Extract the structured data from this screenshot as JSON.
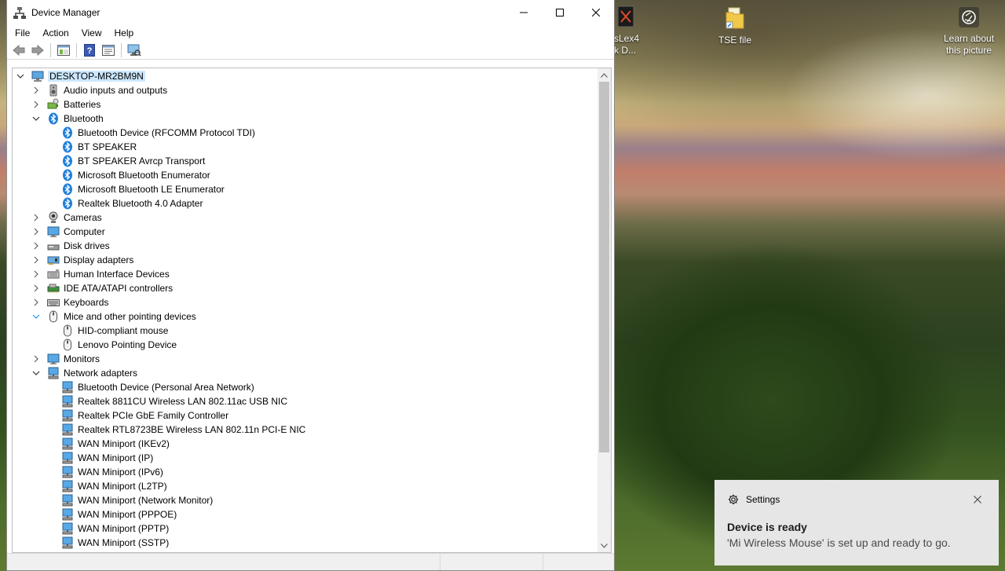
{
  "window": {
    "title": "Device Manager",
    "menu": [
      "File",
      "Action",
      "View",
      "Help"
    ]
  },
  "tree": [
    {
      "label": "DESKTOP-MR2BM9N",
      "level": 0,
      "toggle": "expanded",
      "icon": "computer-icon"
    },
    {
      "label": "Audio inputs and outputs",
      "level": 1,
      "toggle": "collapsed",
      "icon": "speaker-icon"
    },
    {
      "label": "Batteries",
      "level": 1,
      "toggle": "collapsed",
      "icon": "battery-icon"
    },
    {
      "label": "Bluetooth",
      "level": 1,
      "toggle": "expanded",
      "icon": "bluetooth-icon"
    },
    {
      "label": "Bluetooth Device (RFCOMM Protocol TDI)",
      "level": 2,
      "icon": "bluetooth-icon"
    },
    {
      "label": "BT SPEAKER",
      "level": 2,
      "icon": "bluetooth-icon"
    },
    {
      "label": "BT SPEAKER Avrcp Transport",
      "level": 2,
      "icon": "bluetooth-icon"
    },
    {
      "label": "Microsoft Bluetooth Enumerator",
      "level": 2,
      "icon": "bluetooth-icon"
    },
    {
      "label": "Microsoft Bluetooth LE Enumerator",
      "level": 2,
      "icon": "bluetooth-icon"
    },
    {
      "label": "Realtek Bluetooth 4.0 Adapter",
      "level": 2,
      "icon": "bluetooth-icon"
    },
    {
      "label": "Cameras",
      "level": 1,
      "toggle": "collapsed",
      "icon": "camera-icon"
    },
    {
      "label": "Computer",
      "level": 1,
      "toggle": "collapsed",
      "icon": "monitor-icon"
    },
    {
      "label": "Disk drives",
      "level": 1,
      "toggle": "collapsed",
      "icon": "disk-icon"
    },
    {
      "label": "Display adapters",
      "level": 1,
      "toggle": "collapsed",
      "icon": "display-adapter-icon"
    },
    {
      "label": "Human Interface Devices",
      "level": 1,
      "toggle": "collapsed",
      "icon": "hid-icon"
    },
    {
      "label": "IDE ATA/ATAPI controllers",
      "level": 1,
      "toggle": "collapsed",
      "icon": "ide-controller-icon"
    },
    {
      "label": "Keyboards",
      "level": 1,
      "toggle": "collapsed",
      "icon": "keyboard-icon"
    },
    {
      "label": "Mice and other pointing devices",
      "level": 1,
      "toggle": "expanded-hover",
      "icon": "mouse-icon"
    },
    {
      "label": "HID-compliant mouse",
      "level": 2,
      "icon": "mouse-icon"
    },
    {
      "label": "Lenovo Pointing Device",
      "level": 2,
      "icon": "mouse-icon"
    },
    {
      "label": "Monitors",
      "level": 1,
      "toggle": "collapsed",
      "icon": "monitor-icon"
    },
    {
      "label": "Network adapters",
      "level": 1,
      "toggle": "expanded",
      "icon": "network-adapter-icon"
    },
    {
      "label": "Bluetooth Device (Personal Area Network)",
      "level": 2,
      "icon": "network-adapter-icon"
    },
    {
      "label": "Realtek 8811CU Wireless LAN 802.11ac USB NIC",
      "level": 2,
      "icon": "network-adapter-icon"
    },
    {
      "label": "Realtek PCIe GbE Family Controller",
      "level": 2,
      "icon": "network-adapter-icon"
    },
    {
      "label": "Realtek RTL8723BE Wireless LAN 802.11n PCI-E NIC",
      "level": 2,
      "icon": "network-adapter-icon"
    },
    {
      "label": "WAN Miniport (IKEv2)",
      "level": 2,
      "icon": "network-adapter-icon"
    },
    {
      "label": "WAN Miniport (IP)",
      "level": 2,
      "icon": "network-adapter-icon"
    },
    {
      "label": "WAN Miniport (IPv6)",
      "level": 2,
      "icon": "network-adapter-icon"
    },
    {
      "label": "WAN Miniport (L2TP)",
      "level": 2,
      "icon": "network-adapter-icon"
    },
    {
      "label": "WAN Miniport (Network Monitor)",
      "level": 2,
      "icon": "network-adapter-icon"
    },
    {
      "label": "WAN Miniport (PPPOE)",
      "level": 2,
      "icon": "network-adapter-icon"
    },
    {
      "label": "WAN Miniport (PPTP)",
      "level": 2,
      "icon": "network-adapter-icon"
    },
    {
      "label": "WAN Miniport (SSTP)",
      "level": 2,
      "icon": "network-adapter-icon"
    }
  ],
  "desktop": {
    "icons": [
      {
        "label": "sLex4\nk D...",
        "icon": "app-shortcut-icon"
      },
      {
        "label": "TSE file",
        "icon": "folder-icon"
      },
      {
        "label": "Learn about\nthis picture",
        "icon": "camera-lens-icon"
      }
    ]
  },
  "toast": {
    "app": "Settings",
    "title": "Device is ready",
    "body": "'Mi Wireless Mouse' is set up and ready to go."
  }
}
